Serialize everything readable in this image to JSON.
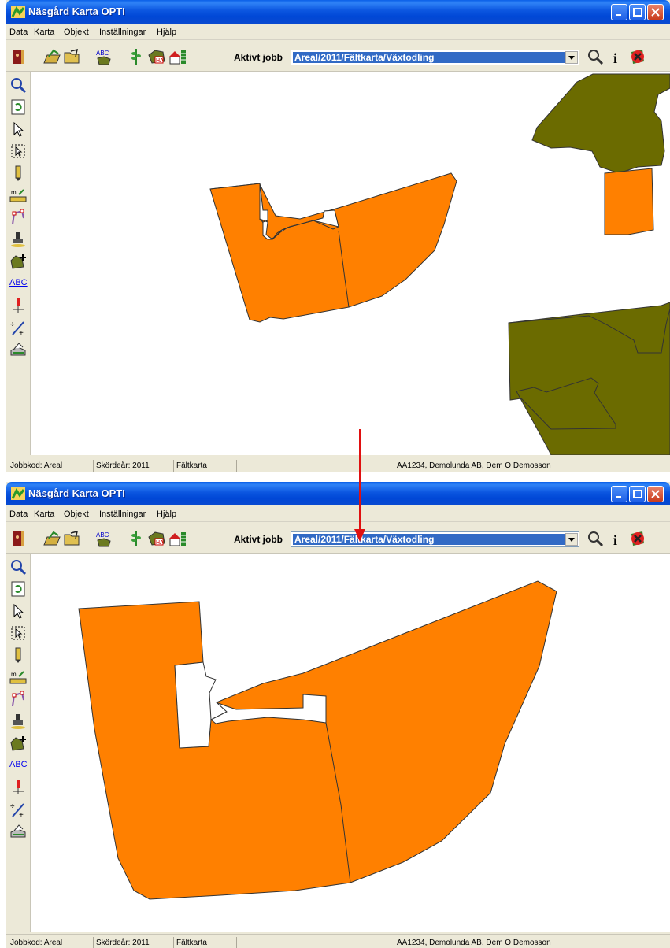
{
  "app": {
    "title": "Näsgård Karta OPTI"
  },
  "menu": {
    "items": [
      "Data",
      "Karta",
      "Objekt",
      "Inställningar",
      "Hjälp"
    ]
  },
  "toolbar": {
    "job_label": "Aktivt jobb",
    "job_value": "Areal/2011/Fältkarta/Växtodling",
    "icons": [
      "exit-icon",
      "open-map-icon",
      "open-folder-icon",
      "abc-label-icon",
      "crop-icon",
      "area-ha-icon",
      "house-icon",
      "search-icon",
      "info-icon",
      "close-red-icon"
    ]
  },
  "left_tools": {
    "icons": [
      "zoom-icon",
      "refresh-icon",
      "pointer-icon",
      "select-icon",
      "pencil-icon",
      "measure-icon",
      "node-edit-icon",
      "stamp-icon",
      "add-field-icon",
      "abc-text-icon",
      "marker-icon",
      "split-icon",
      "print-icon"
    ],
    "abc_label": "ABC"
  },
  "status": {
    "jobbkod": "Jobbkod: Areal",
    "skordear": "Skördeår: 2011",
    "karta": "Fältkarta",
    "owner": "AA1234, Demolunda AB, Dem O Demosson"
  },
  "colors": {
    "field_orange": "#ff8000",
    "field_olive": "#6b6b00",
    "arrow_red": "#e01010",
    "selection_blue": "#316ac5"
  }
}
